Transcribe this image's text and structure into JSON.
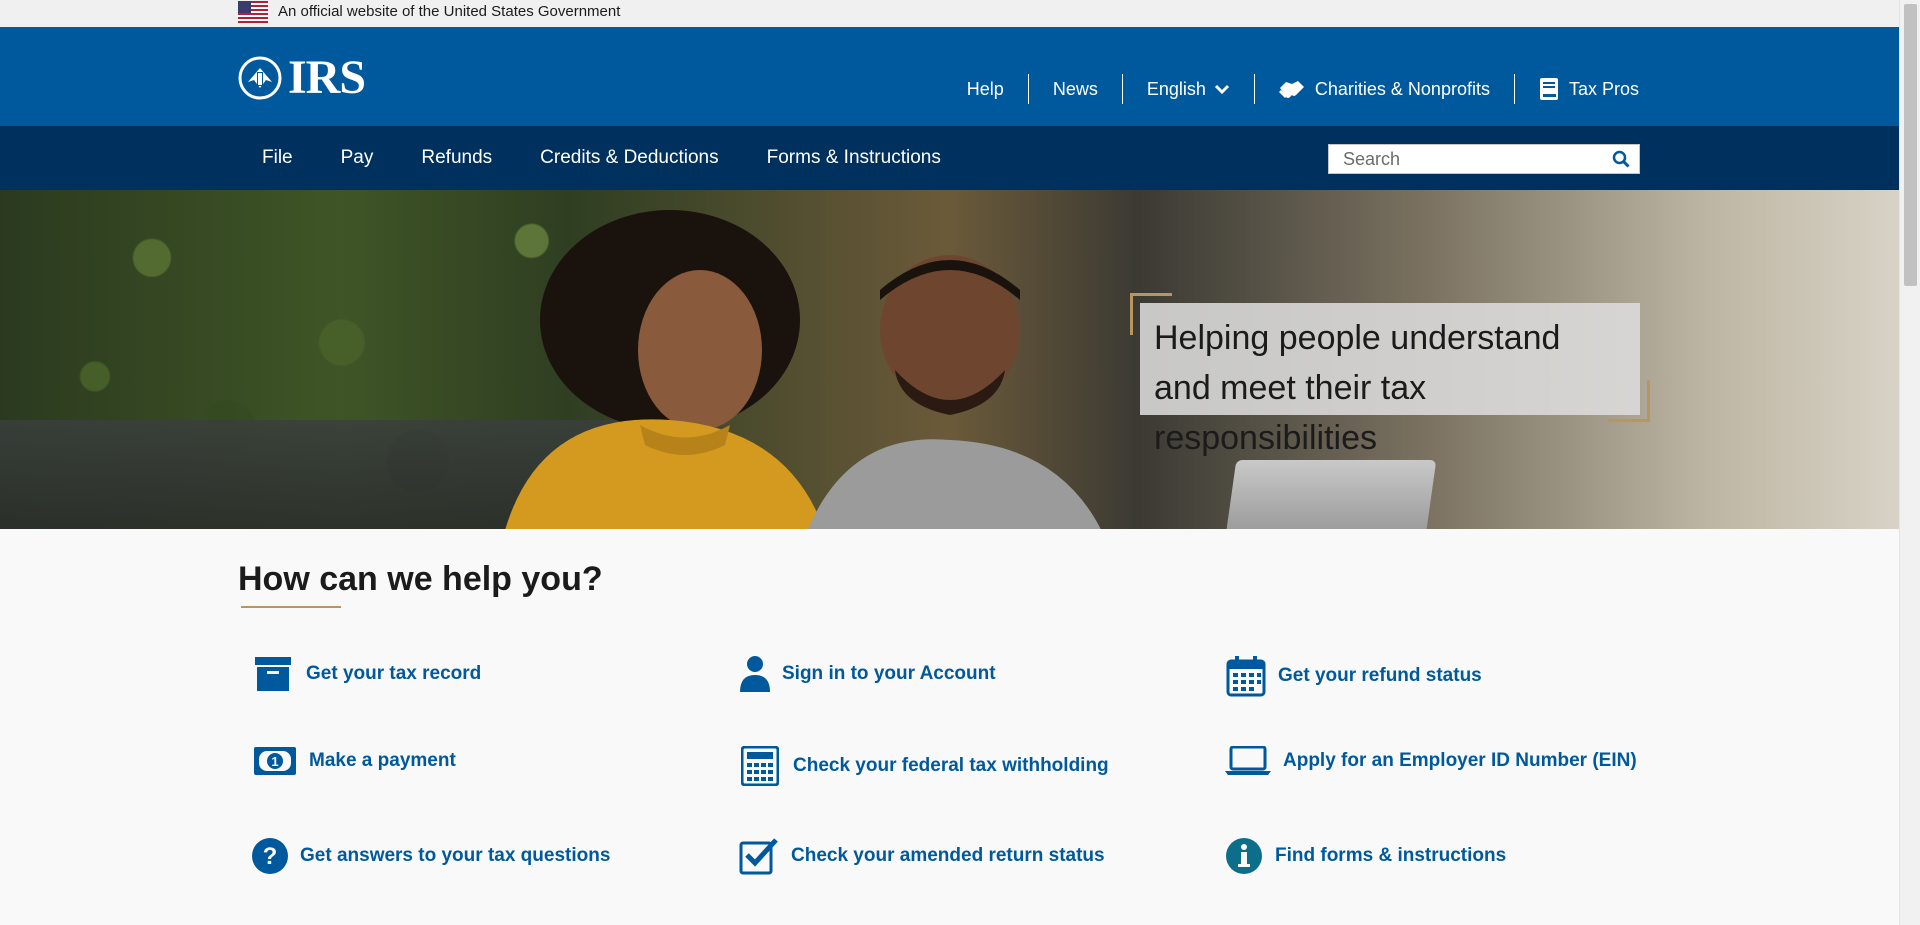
{
  "gov_banner": {
    "text": "An official website of the United States Government",
    "flag_icon": "us-flag-icon"
  },
  "header": {
    "logo_text": "IRS",
    "utility_nav": [
      {
        "label": "Help"
      },
      {
        "label": "News"
      },
      {
        "label": "English",
        "icon": "chevron-down-icon"
      },
      {
        "label": "Charities & Nonprofits",
        "icon": "handshake-icon"
      },
      {
        "label": "Tax Pros",
        "icon": "book-icon"
      }
    ]
  },
  "main_nav": {
    "items": [
      "File",
      "Pay",
      "Refunds",
      "Credits & Deductions",
      "Forms & Instructions"
    ],
    "search_placeholder": "Search"
  },
  "hero": {
    "caption": "Helping people understand and meet their tax responsibilities"
  },
  "help": {
    "title": "How can we help you?",
    "links": [
      {
        "label": "Get your tax record",
        "icon": "archive-box-icon"
      },
      {
        "label": "Sign in to your Account",
        "icon": "user-icon"
      },
      {
        "label": "Get your refund status",
        "icon": "calendar-icon"
      },
      {
        "label": "Make a payment",
        "icon": "money-bill-icon"
      },
      {
        "label": "Check your federal tax withholding",
        "icon": "calculator-icon"
      },
      {
        "label": "Apply for an Employer ID Number (EIN)",
        "icon": "laptop-icon"
      },
      {
        "label": "Get answers to your tax questions",
        "icon": "question-circle-icon"
      },
      {
        "label": "Check your amended return status",
        "icon": "checkbox-icon"
      },
      {
        "label": "Find forms & instructions",
        "icon": "info-circle-icon"
      }
    ]
  },
  "colors": {
    "header_blue": "#00599c",
    "nav_navy": "#00305e",
    "accent_gold": "#b99660",
    "link_blue": "#00599c"
  }
}
